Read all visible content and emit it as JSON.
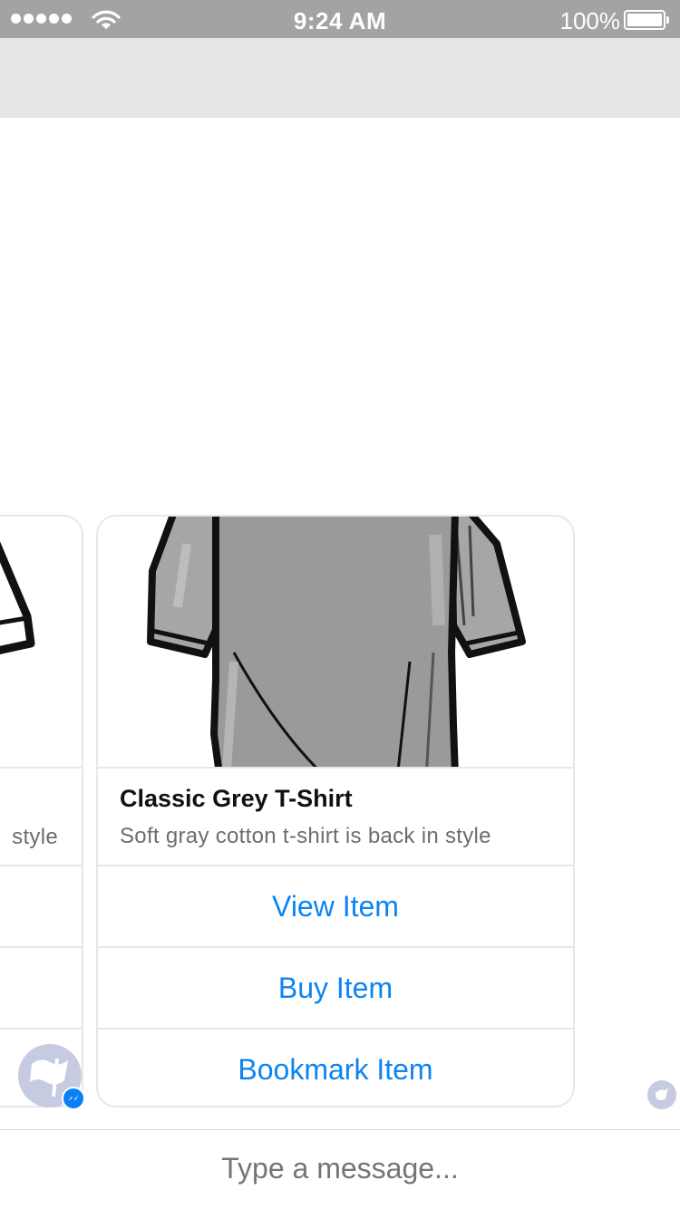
{
  "status_bar": {
    "time": "9:24 AM",
    "battery_percent": "100%",
    "signal_icon": "signal-dots-icon",
    "wifi_icon": "wifi-icon",
    "battery_icon": "battery-icon"
  },
  "colors": {
    "status_bar_bg": "#a3a3a3",
    "header_bg": "#e6e6e6",
    "link_blue": "#0d84f2",
    "avatar_bg": "#c6cbe1"
  },
  "carousel": {
    "previous_card": {
      "subtitle_visible": "style",
      "image_icon": "tshirt-icon"
    },
    "current_card": {
      "title": "Classic Grey T-Shirt",
      "subtitle": "Soft gray cotton t-shirt is back in style",
      "image_icon": "grey-tshirt-icon",
      "buttons": [
        {
          "label": "View Item"
        },
        {
          "label": "Buy Item"
        },
        {
          "label": "Bookmark Item"
        }
      ]
    }
  },
  "bot": {
    "avatar_icon": "flag-icon",
    "badge_icon": "messenger-icon",
    "read_receipt_icon": "read-receipt-icon"
  },
  "composer": {
    "placeholder": "Type a message..."
  }
}
